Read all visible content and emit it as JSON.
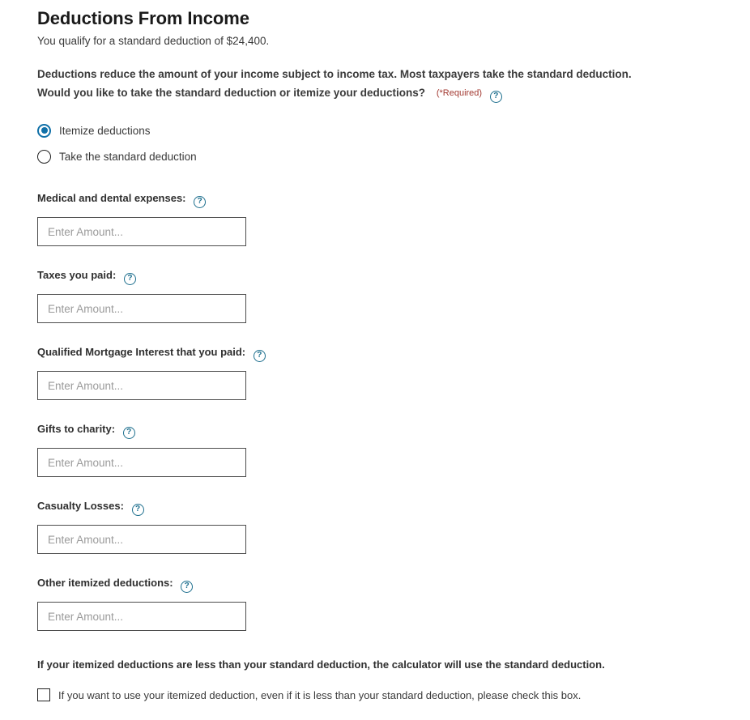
{
  "page": {
    "title": "Deductions From Income",
    "subtitle": "You qualify for a standard deduction of $24,400.",
    "intro_line_1": "Deductions reduce the amount of your income subject to income tax. Most taxpayers take the standard deduction.",
    "intro_line_2": "Would you like to take the standard deduction or itemize your deductions?",
    "required_note": "(*Required)",
    "help_icon_glyph": "?",
    "help_icon_name": "help-circle-icon",
    "accent_color": "#1070a8",
    "help_icon_color": "#1d6f8e",
    "required_color": "#a33a32"
  },
  "deduction_choice": {
    "options": [
      {
        "label": "Itemize deductions",
        "selected": true
      },
      {
        "label": "Take the standard deduction",
        "selected": false
      }
    ]
  },
  "fields": [
    {
      "label": "Medical and dental expenses:",
      "value": "",
      "placeholder": "Enter Amount..."
    },
    {
      "label": "Taxes you paid:",
      "value": "",
      "placeholder": "Enter Amount..."
    },
    {
      "label": "Qualified Mortgage Interest that you paid:",
      "value": "",
      "placeholder": "Enter Amount..."
    },
    {
      "label": "Gifts to charity:",
      "value": "",
      "placeholder": "Enter Amount..."
    },
    {
      "label": "Casualty Losses:",
      "value": "",
      "placeholder": "Enter Amount..."
    },
    {
      "label": "Other itemized deductions:",
      "value": "",
      "placeholder": "Enter Amount..."
    }
  ],
  "footer": {
    "note": "If your itemized deductions are less than your standard deduction, the calculator will use the standard deduction.",
    "checkbox_label": "If you want to use your itemized deduction, even if it is less than your standard deduction, please check this box.",
    "checkbox_checked": false
  }
}
